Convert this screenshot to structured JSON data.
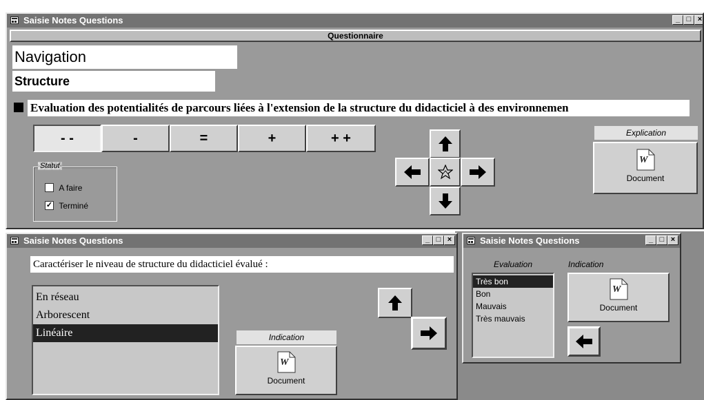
{
  "main_window": {
    "title": "Saisie Notes Questions",
    "section_header": "Questionnaire",
    "breadcrumb_1": "Navigation",
    "breadcrumb_2": "Structure",
    "question": "Evaluation des potentialités de parcours liées à l'extension de la structure du didacticiel à des environnemen",
    "rating_buttons": [
      "- -",
      "-",
      "=",
      "+",
      "+ +"
    ],
    "statut": {
      "label": "Statut",
      "options": [
        {
          "label": "A faire",
          "checked": false
        },
        {
          "label": "Terminé",
          "checked": true
        }
      ]
    },
    "explication": {
      "label": "Explication",
      "doc_label": "Document"
    },
    "nav_icons": [
      "arrow-up-icon",
      "arrow-left-icon",
      "home-star-icon",
      "arrow-right-icon",
      "arrow-down-icon"
    ]
  },
  "window_controls": {
    "minimize": "_",
    "maximize": "□",
    "close": "×"
  },
  "sub_window_left": {
    "title": "Saisie Notes Questions",
    "prompt": "Caractériser le niveau de structure du didacticiel évalué :",
    "options": [
      "En réseau",
      "Arborescent",
      "Linéaire"
    ],
    "selected_index": 2,
    "indication": {
      "label": "Indication",
      "doc_label": "Document"
    }
  },
  "sub_window_right": {
    "title": "Saisie Notes Questions",
    "evaluation_label": "Evaluation",
    "evaluation_options": [
      "Très bon",
      "Bon",
      "Mauvais",
      "Très mauvais"
    ],
    "selected_index": 0,
    "indication": {
      "label": "Indication",
      "doc_label": "Document"
    }
  },
  "colors": {
    "title_bar": "#737373",
    "selection": "#222222",
    "desktop": "#8a8a8a"
  }
}
